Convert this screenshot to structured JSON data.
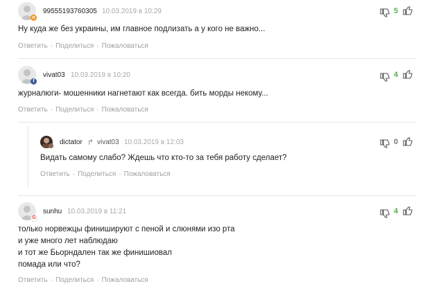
{
  "comments": [
    {
      "author": "99555193760305",
      "date": "10.03.2019 в 10:29",
      "text": [
        "Ну куда же без украины, им главное подлизать а у кого не важно..."
      ],
      "actions": [
        "Ответить",
        "Поделиться",
        "Пожаловаться"
      ],
      "score": "5",
      "badge": "odnoklassniki"
    },
    {
      "author": "vivat03",
      "date": "10.03.2019 в 10:20",
      "text": [
        "журналюги- мошенники нагнетают как всегда. бить морды некому..."
      ],
      "actions": [
        "Ответить",
        "Поделиться",
        "Пожаловаться"
      ],
      "score": "4",
      "badge": "facebook"
    },
    {
      "author": "dictator",
      "reply_to": "vivat03",
      "date": "10.03.2019 в 12:03",
      "text": [
        "Видать самому слабо? Ждешь что кто-то за тебя работу сделает?"
      ],
      "actions": [
        "Ответить",
        "Поделиться",
        "Пожаловаться"
      ],
      "score": "0",
      "badge": "photo"
    },
    {
      "author": "sunhu",
      "date": "10.03.2019 в 11:21",
      "text": [
        "только норвежцы финишируют с пеной и слюнями изо рта",
        "и уже много лет наблюдаю",
        "и тот же Бьорндален так же финишиовал",
        "помада или что?"
      ],
      "actions": [
        "Ответить",
        "Поделиться",
        "Пожаловаться"
      ],
      "score": "4",
      "badge": "google"
    }
  ],
  "colors": {
    "positive": "#52b34a",
    "neutral": "#777777",
    "meta": "#a8a8a8"
  }
}
